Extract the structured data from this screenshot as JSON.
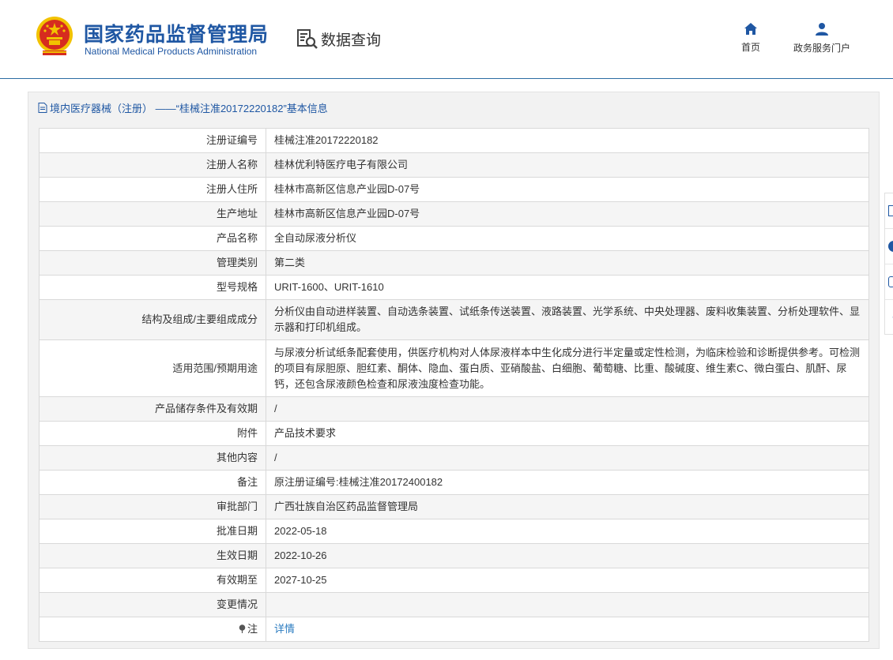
{
  "header": {
    "logo_cn": "国家药品监督管理局",
    "logo_en": "National Medical Products Administration",
    "query_title": "数据查询",
    "nav": [
      {
        "label": "首页",
        "icon": "home-icon"
      },
      {
        "label": "政务服务门户",
        "icon": "user-icon"
      }
    ]
  },
  "panel": {
    "title": "境内医疗器械（注册） ——“桂械注准20172220182”基本信息"
  },
  "rows": [
    {
      "label": "注册证编号",
      "value": "桂械注准20172220182"
    },
    {
      "label": "注册人名称",
      "value": "桂林优利特医疗电子有限公司"
    },
    {
      "label": "注册人住所",
      "value": "桂林市高新区信息产业园D-07号"
    },
    {
      "label": "生产地址",
      "value": "桂林市高新区信息产业园D-07号"
    },
    {
      "label": "产品名称",
      "value": "全自动尿液分析仪"
    },
    {
      "label": "管理类别",
      "value": "第二类"
    },
    {
      "label": "型号规格",
      "value": "URIT-1600、URIT-1610"
    },
    {
      "label": "结构及组成/主要组成成分",
      "value": "分析仪由自动进样装置、自动选条装置、试纸条传送装置、液路装置、光学系统、中央处理器、废料收集装置、分析处理软件、显示器和打印机组成。"
    },
    {
      "label": "适用范围/预期用途",
      "value": "与尿液分析试纸条配套使用，供医疗机构对人体尿液样本中生化成分进行半定量或定性检测，为临床检验和诊断提供参考。可检测的项目有尿胆原、胆红素、酮体、隐血、蛋白质、亚硝酸盐、白细胞、葡萄糖、比重、酸碱度、维生素C、微白蛋白、肌酐、尿钙，还包含尿液颜色检查和尿液浊度检查功能。"
    },
    {
      "label": "产品储存条件及有效期",
      "value": "/"
    },
    {
      "label": "附件",
      "value": "产品技术要求"
    },
    {
      "label": "其他内容",
      "value": "/"
    },
    {
      "label": "备注",
      "value": "原注册证编号:桂械注准20172400182"
    },
    {
      "label": "审批部门",
      "value": "广西壮族自治区药品监督管理局"
    },
    {
      "label": "批准日期",
      "value": "2022-05-18"
    },
    {
      "label": "生效日期",
      "value": "2022-10-26"
    },
    {
      "label": "有效期至",
      "value": "2027-10-25"
    },
    {
      "label": "变更情况",
      "value": ""
    },
    {
      "label": "注",
      "value": "详情"
    }
  ],
  "colors": {
    "brand_blue": "#1f57a3",
    "link_blue": "#2a7bc0",
    "panel_bg": "#f2f2f2",
    "emblem_red": "#d62c1f",
    "emblem_gold": "#f2c200"
  }
}
